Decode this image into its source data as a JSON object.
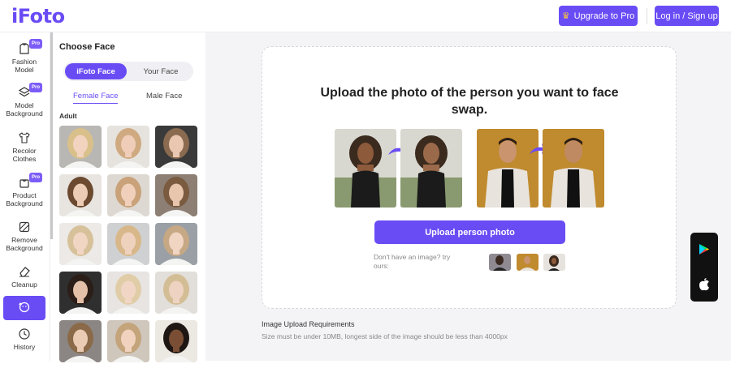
{
  "header": {
    "logo": "iFoto",
    "upgrade_label": "Upgrade to Pro",
    "login_label": "Log in / Sign up"
  },
  "sidebar": {
    "items": [
      {
        "label": "Fashion Model",
        "pro": "Pro"
      },
      {
        "label": "Model Background",
        "pro": "Pro"
      },
      {
        "label": "Recolor Clothes"
      },
      {
        "label": "Product Background",
        "pro": "Pro"
      },
      {
        "label": "Remove Background"
      },
      {
        "label": "Cleanup"
      },
      {
        "label": "Face Swap"
      },
      {
        "label": "History"
      }
    ]
  },
  "panel": {
    "title": "Choose Face",
    "segments": [
      "iFoto Face",
      "Your Face"
    ],
    "tabs": [
      "Female Face",
      "Male Face"
    ],
    "group": "Adult"
  },
  "main": {
    "headline": "Upload the photo of the person you want to face swap.",
    "upload_label": "Upload person photo",
    "no_image_text": "Don't have an image? try ours:",
    "requirements_title": "Image Upload Requirements",
    "requirements_text": "Size must be under 10MB, longest side of the image should be less than 4000px"
  },
  "colors": {
    "accent": "#6a4cf5",
    "background": "#f4f4f7"
  }
}
